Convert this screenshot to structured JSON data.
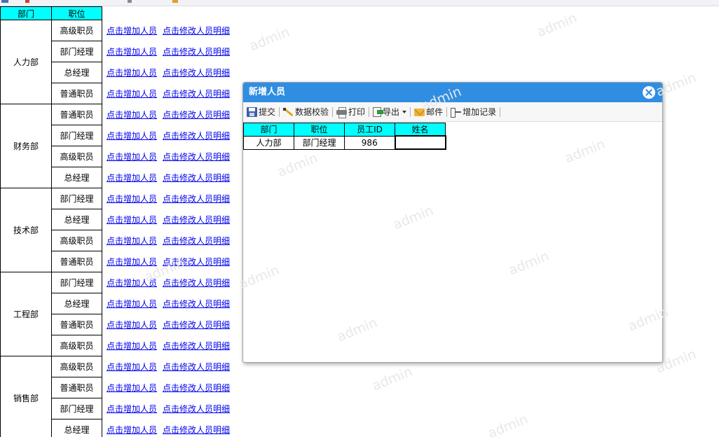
{
  "report": {
    "header": {
      "dept": "部门",
      "position": "职位"
    },
    "link_add": "点击增加人员",
    "link_edit": "点击修改人员明细",
    "groups": [
      {
        "dept": "人力部",
        "positions": [
          "高级职员",
          "部门经理",
          "总经理",
          "普通职员"
        ]
      },
      {
        "dept": "财务部",
        "positions": [
          "普通职员",
          "部门经理",
          "高级职员",
          "总经理"
        ]
      },
      {
        "dept": "技术部",
        "positions": [
          "部门经理",
          "总经理",
          "高级职员",
          "普通职员"
        ]
      },
      {
        "dept": "工程部",
        "positions": [
          "部门经理",
          "总经理",
          "普通职员",
          "高级职员"
        ]
      },
      {
        "dept": "销售部",
        "positions": [
          "高级职员",
          "普通职员",
          "部门经理",
          "总经理"
        ]
      }
    ]
  },
  "dialog": {
    "title": "新增人员",
    "toolbar": [
      {
        "icon": "save-icon",
        "label": "提交"
      },
      {
        "icon": "check-icon",
        "label": "数据校验"
      },
      {
        "icon": "print-icon",
        "label": "打印"
      },
      {
        "icon": "export-icon",
        "label": "导出",
        "dropdown": true
      },
      {
        "icon": "mail-icon",
        "label": "邮件"
      },
      {
        "icon": "add-record-icon",
        "label": "增加记录"
      }
    ],
    "form": {
      "headers": [
        "部门",
        "职位",
        "员工ID",
        "姓名"
      ],
      "row": {
        "dept": "人力部",
        "position": "部门经理",
        "employee_id": "986",
        "name": ""
      }
    }
  },
  "watermark": "admin",
  "colors": {
    "header_bg": "#00ffff",
    "dialog_title_bg": "#2f8ee2",
    "link": "#0000ee"
  }
}
